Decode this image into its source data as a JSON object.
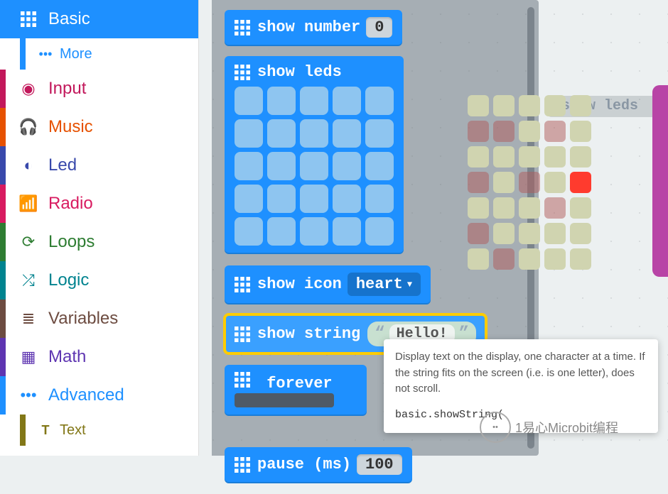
{
  "sidebar": {
    "categories": [
      {
        "label": "Basic",
        "color": "#1e90ff",
        "active": true
      },
      {
        "label": "More",
        "color": "#1e90ff",
        "sub": true
      },
      {
        "label": "Input",
        "color": "#c2185b"
      },
      {
        "label": "Music",
        "color": "#e65100"
      },
      {
        "label": "Led",
        "color": "#3949ab"
      },
      {
        "label": "Radio",
        "color": "#d81b60"
      },
      {
        "label": "Loops",
        "color": "#2e7d32"
      },
      {
        "label": "Logic",
        "color": "#00838f"
      },
      {
        "label": "Variables",
        "color": "#6d4c41"
      },
      {
        "label": "Math",
        "color": "#5e35b1"
      },
      {
        "label": "Advanced",
        "color": "#1e90ff"
      },
      {
        "label": "Text",
        "color": "#827717",
        "sub": true
      }
    ]
  },
  "blocks": {
    "show_number": {
      "label": "show number",
      "value": "0"
    },
    "show_leds": {
      "label": "show leds"
    },
    "show_icon": {
      "label": "show icon",
      "value": "heart"
    },
    "show_string": {
      "label": "show string",
      "value": "Hello!"
    },
    "forever": {
      "label": "forever"
    },
    "pause": {
      "label": "pause (ms)",
      "value": "100"
    }
  },
  "shadow_block": {
    "label": "show leds"
  },
  "tooltip": {
    "text": "Display text on the display, one character at a time. If the string fits on the screen (i.e. is one letter), does not scroll.",
    "code": "basic.showString("
  },
  "watermark": "1易心Microbit编程",
  "led_preview_pattern": [
    [
      0,
      0,
      0,
      0,
      0
    ],
    [
      1,
      1,
      0,
      1,
      0
    ],
    [
      0,
      0,
      0,
      0,
      0
    ],
    [
      1,
      0,
      1,
      0,
      2
    ],
    [
      0,
      0,
      0,
      1,
      0
    ],
    [
      1,
      0,
      0,
      0,
      0
    ],
    [
      0,
      1,
      0,
      0,
      0
    ]
  ]
}
